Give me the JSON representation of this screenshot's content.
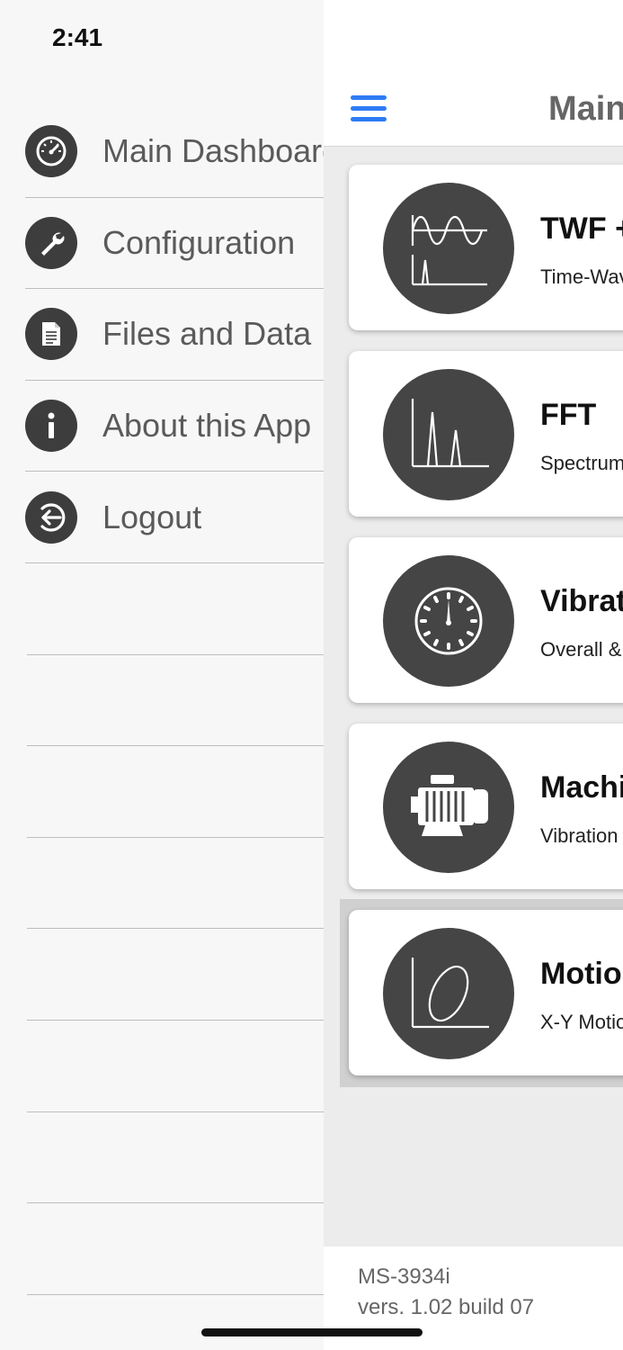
{
  "status": {
    "time": "2:41"
  },
  "menu": {
    "items": [
      {
        "label": "Main Dashboard",
        "icon": "dashboard-gauge-icon"
      },
      {
        "label": "Configuration",
        "icon": "wrench-icon"
      },
      {
        "label": "Files and Data",
        "icon": "document-icon"
      },
      {
        "label": "About this App",
        "icon": "info-icon"
      },
      {
        "label": "Logout",
        "icon": "logout-icon"
      }
    ]
  },
  "header": {
    "title": "Main Dashboard"
  },
  "cards": [
    {
      "title": "TWF + FFT",
      "subtitle": "Time-Waveform",
      "icon": "waveform-icon"
    },
    {
      "title": "FFT",
      "subtitle": "Spectrum",
      "icon": "spectrum-icon"
    },
    {
      "title": "Vibration",
      "subtitle": "Overall &",
      "icon": "gauge-icon"
    },
    {
      "title": "Machine",
      "subtitle": "Vibration",
      "icon": "motor-icon"
    },
    {
      "title": "Motion",
      "subtitle": "X-Y Motion",
      "icon": "orbit-icon"
    }
  ],
  "footer": {
    "model": "MS-3934i",
    "version": "vers. 1.02 build 07"
  },
  "colors": {
    "accent": "#2f7bf5",
    "icon_bg": "#454545"
  }
}
